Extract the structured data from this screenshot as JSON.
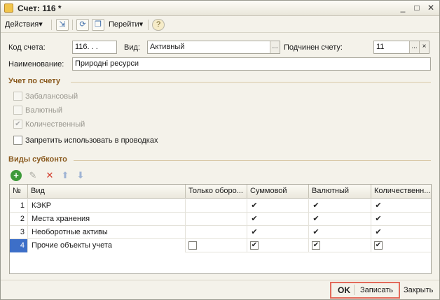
{
  "window": {
    "title": "Счет: 116 *",
    "minimize_glyph": "_",
    "maximize_glyph": "□",
    "close_glyph": "✕"
  },
  "toolbar": {
    "actions_label": "Действия",
    "goto_label": "Перейти",
    "dropdown_glyph": "▾",
    "help_glyph": "?"
  },
  "form": {
    "code_label": "Код счета:",
    "code_value": "116. . .",
    "kind_label": "Вид:",
    "kind_value": "Активный",
    "parent_label": "Подчинен счету:",
    "parent_value": "11",
    "select_glyph": "...",
    "clear_glyph": "×",
    "name_label": "Наименование:",
    "name_value": "Природні ресурси"
  },
  "accounting": {
    "title": "Учет по счету",
    "options": [
      {
        "label": "Забалансовый",
        "checked": false,
        "enabled": false
      },
      {
        "label": "Валютный",
        "checked": false,
        "enabled": false
      },
      {
        "label": "Количественный",
        "checked": true,
        "enabled": false
      }
    ],
    "forbid_label": "Запретить использовать в проводках",
    "forbid_checked": false
  },
  "subconto": {
    "title": "Виды субконто",
    "icons": [
      "add-icon",
      "edit-icon",
      "delete-icon",
      "move-up-icon",
      "move-down-icon"
    ],
    "columns": [
      "№",
      "Вид",
      "Только оборо...",
      "Суммовой",
      "Валютный",
      "Количественн..."
    ],
    "rows": [
      {
        "num": "1",
        "vid": "КЭКР",
        "turnover_only": false,
        "sum": true,
        "currency": true,
        "quantity": true
      },
      {
        "num": "2",
        "vid": "Места хранения",
        "turnover_only": false,
        "sum": true,
        "currency": true,
        "quantity": true
      },
      {
        "num": "3",
        "vid": "Необоротные активы",
        "turnover_only": false,
        "sum": true,
        "currency": true,
        "quantity": true
      },
      {
        "num": "4",
        "vid": "Прочие объекты учета",
        "turnover_only": false,
        "sum": true,
        "currency": true,
        "quantity": true
      }
    ],
    "check_glyph": "✔"
  },
  "footer": {
    "ok_label": "OK",
    "save_label": "Записать",
    "close_label": "Закрыть",
    "highlight_color": "#e26a5a"
  }
}
